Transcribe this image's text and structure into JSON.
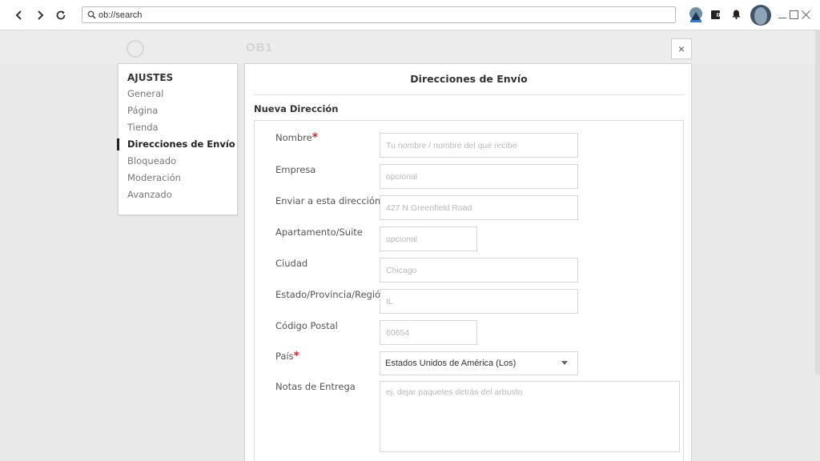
{
  "browser": {
    "address": "ob://search"
  },
  "background": {
    "ghost_brand": "OB1"
  },
  "sidebar": {
    "heading": "AJUSTES",
    "items": [
      {
        "label": "General"
      },
      {
        "label": "Página"
      },
      {
        "label": "Tienda"
      },
      {
        "label": "Direcciones de Envío"
      },
      {
        "label": "Bloqueado"
      },
      {
        "label": "Moderación"
      },
      {
        "label": "Avanzado"
      }
    ],
    "active_index": 3
  },
  "modal": {
    "close_label": "×",
    "title": "Direcciones de Envío",
    "section_title": "Nueva Dirección"
  },
  "form": {
    "required_mark": "*",
    "name": {
      "label": "Nombre",
      "placeholder": "Tu nombre / nombre del que recibe"
    },
    "company": {
      "label": "Empresa",
      "placeholder": "opcional"
    },
    "address": {
      "label": "Enviar a esta dirección",
      "placeholder": "427 N Greenfield Road"
    },
    "suite": {
      "label": "Apartamento/Suite",
      "placeholder": "opcional"
    },
    "city": {
      "label": "Ciudad",
      "placeholder": "Chicago"
    },
    "state": {
      "label": "Estado/Provincia/Región",
      "placeholder": "IL"
    },
    "postal": {
      "label": "Código Postal",
      "placeholder": "60654"
    },
    "country": {
      "label": "País",
      "value": "Estados Unidos de América (Los)"
    },
    "notes": {
      "label": "Notas de Entrega",
      "placeholder": "ej. dejar paquetes detrás del arbusto"
    }
  },
  "icons": {
    "back": "chevron-left-icon",
    "forward": "chevron-right-icon",
    "reload": "reload-icon",
    "search": "magnifier-icon",
    "wallet": "wallet-icon",
    "notifications": "bell-icon",
    "minimize": "minimize-icon",
    "maximize": "maximize-icon",
    "close": "close-icon"
  },
  "colors": {
    "required": "#d9262e",
    "active_accent": "#222222"
  }
}
